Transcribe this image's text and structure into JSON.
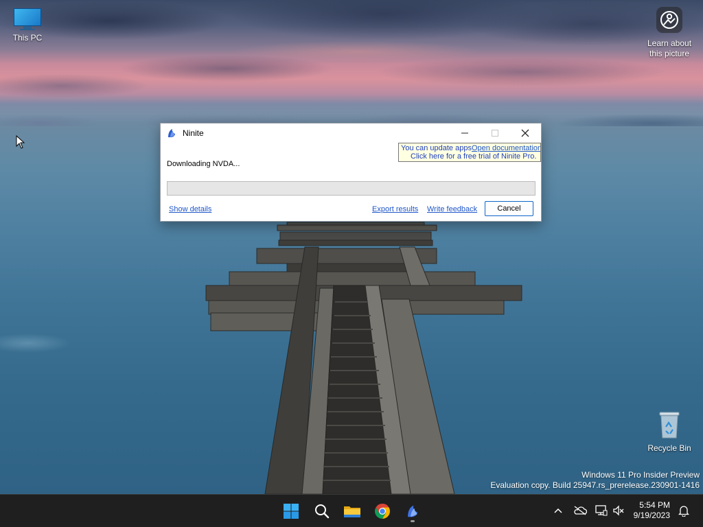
{
  "desktop": {
    "icons": {
      "this_pc": "This PC",
      "learn_about": "Learn about this picture",
      "recycle_bin": "Recycle Bin"
    },
    "watermark": {
      "line1": "Windows 11 Pro Insider Preview",
      "line2": "Evaluation copy. Build 25947.rs_prerelease.230901-1416"
    }
  },
  "ninite_window": {
    "title": "Ninite",
    "status_text": "Downloading NVDA...",
    "progress_fraction": 0,
    "tooltip": {
      "line1": "You can update apps",
      "link": "Open documentation",
      "line2": "Click here for a free trial of Ninite Pro."
    },
    "show_details_label": "Show details",
    "export_results_label": "Export results",
    "write_feedback_label": "Write feedback",
    "cancel_label": "Cancel"
  },
  "taskbar": {
    "apps": [
      "start-icon",
      "search-icon",
      "file-explorer-icon",
      "chrome-icon",
      "ninite-icon"
    ],
    "clock": {
      "time": "5:54 PM",
      "date": "9/19/2023"
    }
  },
  "colors": {
    "accent": "#0a64c8",
    "taskbar_bg": "#1f1f1f",
    "link": "#1e56c8",
    "tooltip_bg": "#ffffe1"
  }
}
